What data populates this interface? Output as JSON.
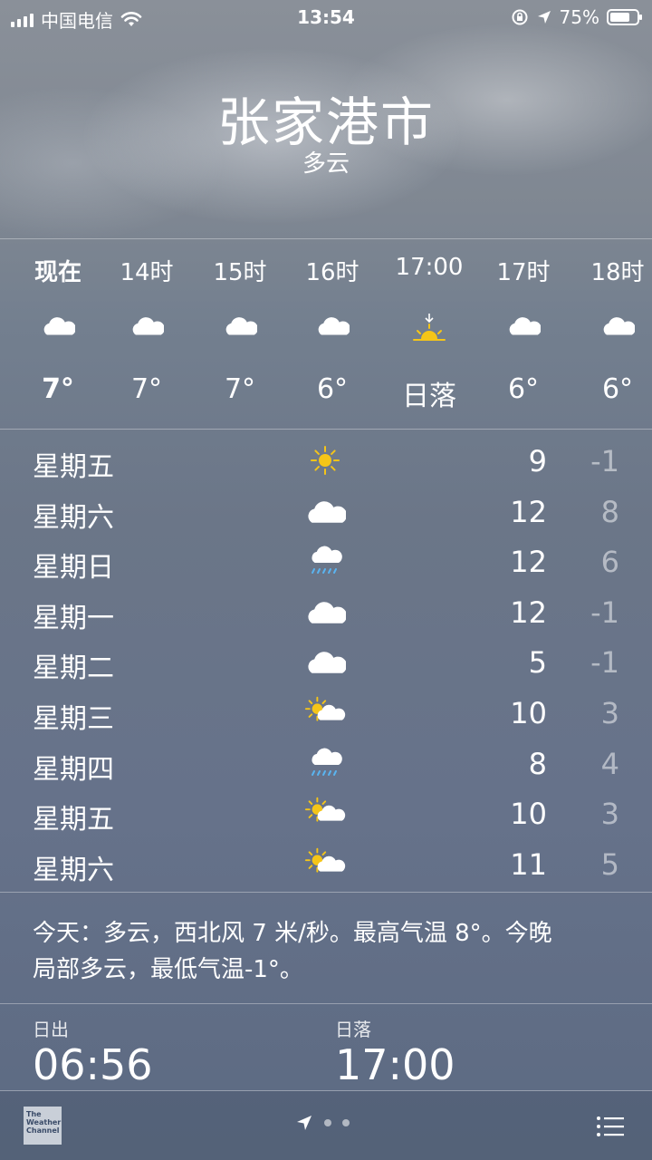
{
  "status_bar": {
    "carrier": "中国电信",
    "time": "13:54",
    "battery_percent": "75%",
    "battery_level": 0.75,
    "icons": [
      "signal-icon",
      "wifi-icon",
      "rotation-lock-icon",
      "location-arrow-icon",
      "battery-icon"
    ]
  },
  "header": {
    "city": "张家港市",
    "condition": "多云"
  },
  "hourly": [
    {
      "time": "现在",
      "icon": "cloud-icon",
      "temp": "7°",
      "bold": true
    },
    {
      "time": "14时",
      "icon": "cloud-icon",
      "temp": "7°"
    },
    {
      "time": "15时",
      "icon": "cloud-icon",
      "temp": "7°"
    },
    {
      "time": "16时",
      "icon": "cloud-icon",
      "temp": "6°"
    },
    {
      "time": "17:00",
      "icon": "sunset-icon",
      "temp": "日落"
    },
    {
      "time": "17时",
      "icon": "cloud-icon",
      "temp": "6°"
    },
    {
      "time": "18时",
      "icon": "cloud-icon",
      "temp": "6°"
    }
  ],
  "daily": [
    {
      "day": "星期五",
      "icon": "sun-icon",
      "high": "9",
      "low": "-1"
    },
    {
      "day": "星期六",
      "icon": "cloud-icon",
      "high": "12",
      "low": "8"
    },
    {
      "day": "星期日",
      "icon": "rain-icon",
      "high": "12",
      "low": "6"
    },
    {
      "day": "星期一",
      "icon": "cloud-icon",
      "high": "12",
      "low": "-1"
    },
    {
      "day": "星期二",
      "icon": "cloud-icon",
      "high": "5",
      "low": "-1"
    },
    {
      "day": "星期三",
      "icon": "partly-sunny-icon",
      "high": "10",
      "low": "3"
    },
    {
      "day": "星期四",
      "icon": "rain-icon",
      "high": "8",
      "low": "4"
    },
    {
      "day": "星期五",
      "icon": "partly-sunny-icon",
      "high": "10",
      "low": "3"
    },
    {
      "day": "星期六",
      "icon": "partly-sunny-icon",
      "high": "11",
      "low": "5"
    }
  ],
  "summary": {
    "line1": "今天：多云，西北风 7 米/秒。最高气温 8°。今晚",
    "line2": "局部多云，最低气温-1°。"
  },
  "sun": {
    "sunrise_label": "日出",
    "sunrise_time": "06:56",
    "sunset_label": "日落",
    "sunset_time": "17:00"
  },
  "bottom_bar": {
    "logo_text": "The Weather Channel",
    "page_count": 2,
    "icons": [
      "weather-channel-logo",
      "location-arrow-icon",
      "page-dot",
      "list-icon"
    ]
  },
  "colors": {
    "sun": "#f5c518",
    "rain": "#5ab4f0",
    "cloud": "#ffffff"
  }
}
